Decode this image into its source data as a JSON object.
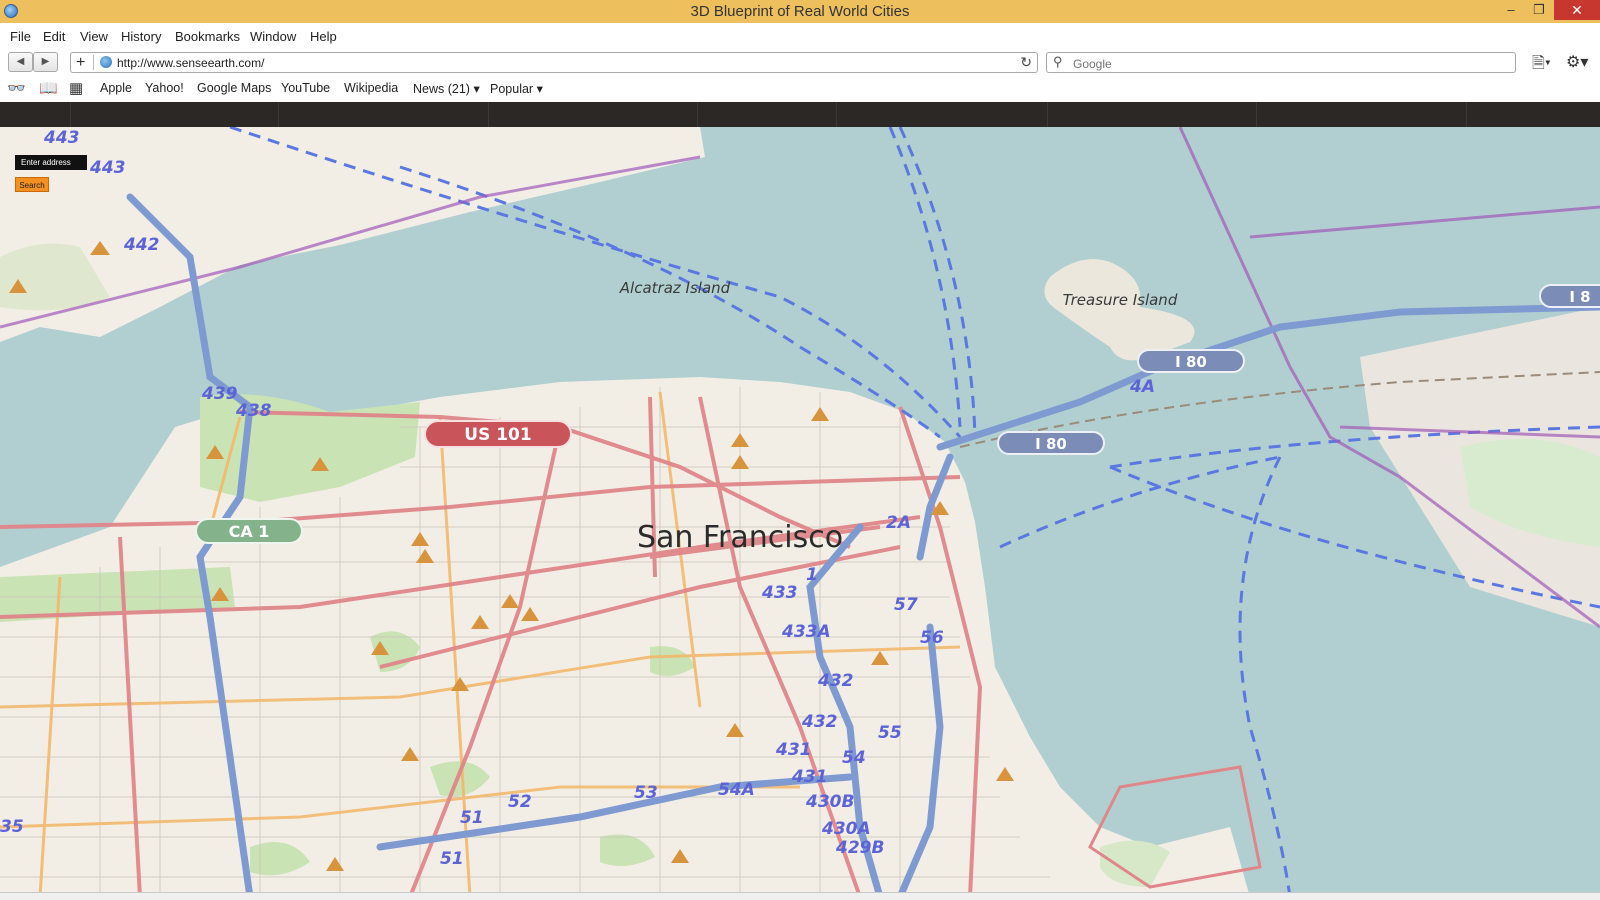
{
  "window": {
    "title": "3D Blueprint of Real World Cities"
  },
  "menu": [
    "File",
    "Edit",
    "View",
    "History",
    "Bookmarks",
    "Window",
    "Help"
  ],
  "toolbar": {
    "url": "http://www.senseearth.com/",
    "search_placeholder": "Google"
  },
  "bookmarks": [
    "Apple",
    "Yahoo!",
    "Google Maps",
    "YouTube",
    "Wikipedia",
    "News (21)",
    "Popular"
  ],
  "page": {
    "address_placeholder": "Enter address",
    "search_label": "Search"
  },
  "map": {
    "city_label": "San Francisco",
    "islands": [
      "Alcatraz Island",
      "Treasure Island"
    ],
    "shields": [
      "US 101",
      "CA 1",
      "I 80",
      "I 80",
      "I 8"
    ],
    "exits": [
      "443",
      "443",
      "442",
      "439",
      "438",
      "2A",
      "1",
      "433",
      "433A",
      "432",
      "432",
      "431",
      "431",
      "430B",
      "430A",
      "429B",
      "57",
      "56",
      "55",
      "54",
      "54A",
      "53",
      "52",
      "51",
      "51",
      "4A",
      "35"
    ]
  },
  "colors": {
    "titlebar": "#edc05d",
    "water": "#b1cfd0",
    "land": "#f2eee6",
    "park": "#c9e3b5",
    "major_road": "#e0868a",
    "highway": "#7f9ad0",
    "secondary_road": "#f2b86d",
    "search_button": "#f39020"
  }
}
